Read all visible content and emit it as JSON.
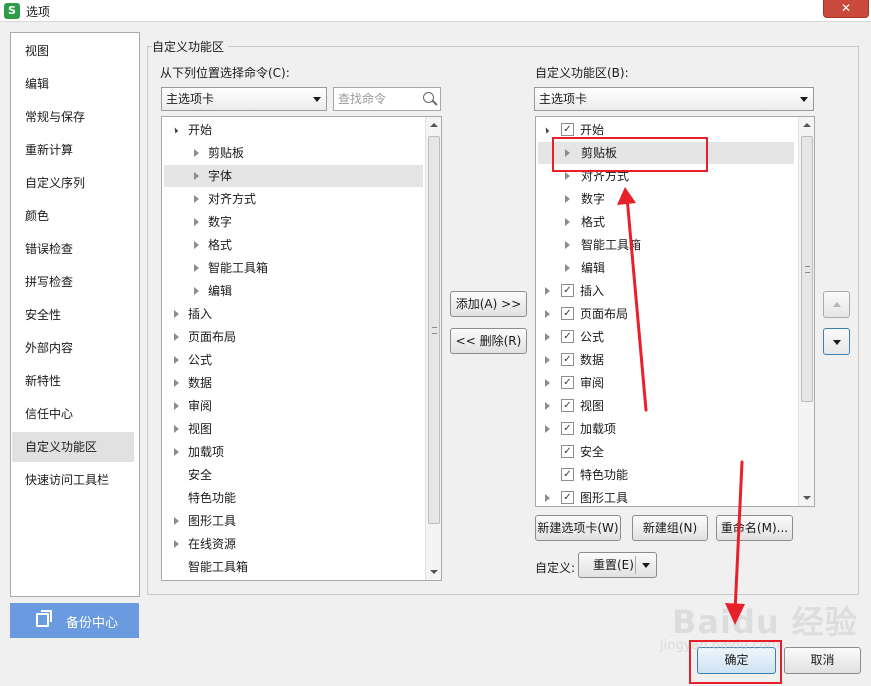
{
  "window": {
    "title": "选项",
    "app_icon_letter": "S",
    "close_glyph": "✕"
  },
  "nav": {
    "items": [
      "视图",
      "编辑",
      "常规与保存",
      "重新计算",
      "自定义序列",
      "颜色",
      "错误检查",
      "拼写检查",
      "安全性",
      "外部内容",
      "新特性",
      "信任中心",
      "自定义功能区",
      "快速访问工具栏"
    ],
    "active_index": 12,
    "backup_label": "备份中心"
  },
  "group": {
    "title": "自定义功能区"
  },
  "left": {
    "label": "从下列位置选择命令(C):",
    "combo_value": "主选项卡",
    "search_placeholder": "查找命令",
    "items": [
      {
        "text": "开始",
        "level": 0,
        "expand": "open",
        "selected": false
      },
      {
        "text": "剪贴板",
        "level": 1,
        "expand": "closed",
        "selected": false
      },
      {
        "text": "字体",
        "level": 1,
        "expand": "closed",
        "selected": true
      },
      {
        "text": "对齐方式",
        "level": 1,
        "expand": "closed",
        "selected": false
      },
      {
        "text": "数字",
        "level": 1,
        "expand": "closed",
        "selected": false
      },
      {
        "text": "格式",
        "level": 1,
        "expand": "closed",
        "selected": false
      },
      {
        "text": "智能工具箱",
        "level": 1,
        "expand": "closed",
        "selected": false
      },
      {
        "text": "编辑",
        "level": 1,
        "expand": "closed",
        "selected": false
      },
      {
        "text": "插入",
        "level": 0,
        "expand": "closed",
        "selected": false
      },
      {
        "text": "页面布局",
        "level": 0,
        "expand": "closed",
        "selected": false
      },
      {
        "text": "公式",
        "level": 0,
        "expand": "closed",
        "selected": false
      },
      {
        "text": "数据",
        "level": 0,
        "expand": "closed",
        "selected": false
      },
      {
        "text": "审阅",
        "level": 0,
        "expand": "closed",
        "selected": false
      },
      {
        "text": "视图",
        "level": 0,
        "expand": "closed",
        "selected": false
      },
      {
        "text": "加载项",
        "level": 0,
        "expand": "closed",
        "selected": false
      },
      {
        "text": "安全",
        "level": 0,
        "expand": "none",
        "selected": false
      },
      {
        "text": "特色功能",
        "level": 0,
        "expand": "none",
        "selected": false
      },
      {
        "text": "图形工具",
        "level": 0,
        "expand": "closed",
        "selected": false
      },
      {
        "text": "在线资源",
        "level": 0,
        "expand": "closed",
        "selected": false
      },
      {
        "text": "智能工具箱",
        "level": 0,
        "expand": "none",
        "selected": false
      }
    ]
  },
  "middle": {
    "add_label": "添加(A) >>",
    "remove_label": "<< 删除(R)"
  },
  "right": {
    "label": "自定义功能区(B):",
    "combo_value": "主选项卡",
    "items": [
      {
        "text": "开始",
        "level": 0,
        "expand": "open",
        "checkbox": true,
        "checked": true,
        "selected": false
      },
      {
        "text": "剪贴板",
        "level": 1,
        "expand": "closed",
        "checkbox": false,
        "checked": false,
        "selected": true
      },
      {
        "text": "对齐方式",
        "level": 1,
        "expand": "closed",
        "checkbox": false,
        "checked": false,
        "selected": false
      },
      {
        "text": "数字",
        "level": 1,
        "expand": "closed",
        "checkbox": false,
        "checked": false,
        "selected": false
      },
      {
        "text": "格式",
        "level": 1,
        "expand": "closed",
        "checkbox": false,
        "checked": false,
        "selected": false
      },
      {
        "text": "智能工具箱",
        "level": 1,
        "expand": "closed",
        "checkbox": false,
        "checked": false,
        "selected": false
      },
      {
        "text": "编辑",
        "level": 1,
        "expand": "closed",
        "checkbox": false,
        "checked": false,
        "selected": false
      },
      {
        "text": "插入",
        "level": 0,
        "expand": "closed",
        "checkbox": true,
        "checked": true,
        "selected": false
      },
      {
        "text": "页面布局",
        "level": 0,
        "expand": "closed",
        "checkbox": true,
        "checked": true,
        "selected": false
      },
      {
        "text": "公式",
        "level": 0,
        "expand": "closed",
        "checkbox": true,
        "checked": true,
        "selected": false
      },
      {
        "text": "数据",
        "level": 0,
        "expand": "closed",
        "checkbox": true,
        "checked": true,
        "selected": false
      },
      {
        "text": "审阅",
        "level": 0,
        "expand": "closed",
        "checkbox": true,
        "checked": true,
        "selected": false
      },
      {
        "text": "视图",
        "level": 0,
        "expand": "closed",
        "checkbox": true,
        "checked": true,
        "selected": false
      },
      {
        "text": "加载项",
        "level": 0,
        "expand": "closed",
        "checkbox": true,
        "checked": true,
        "selected": false
      },
      {
        "text": "安全",
        "level": 0,
        "expand": "none",
        "checkbox": true,
        "checked": true,
        "selected": false
      },
      {
        "text": "特色功能",
        "level": 0,
        "expand": "none",
        "checkbox": true,
        "checked": true,
        "selected": false
      },
      {
        "text": "图形工具",
        "level": 0,
        "expand": "closed",
        "checkbox": true,
        "checked": true,
        "selected": false
      }
    ],
    "new_tab_label": "新建选项卡(W)",
    "new_group_label": "新建组(N)",
    "rename_label": "重命名(M)...",
    "customize_label": "自定义:",
    "reset_label": "重置(E)"
  },
  "footer": {
    "ok_label": "确定",
    "cancel_label": "取消"
  },
  "watermark": {
    "brand": "Baidu 经验",
    "url": "jingyan.baidu.com"
  },
  "colors": {
    "annotation_red": "#e8202a",
    "backup_blue": "#6a9be0",
    "checked_tick": "✓"
  }
}
